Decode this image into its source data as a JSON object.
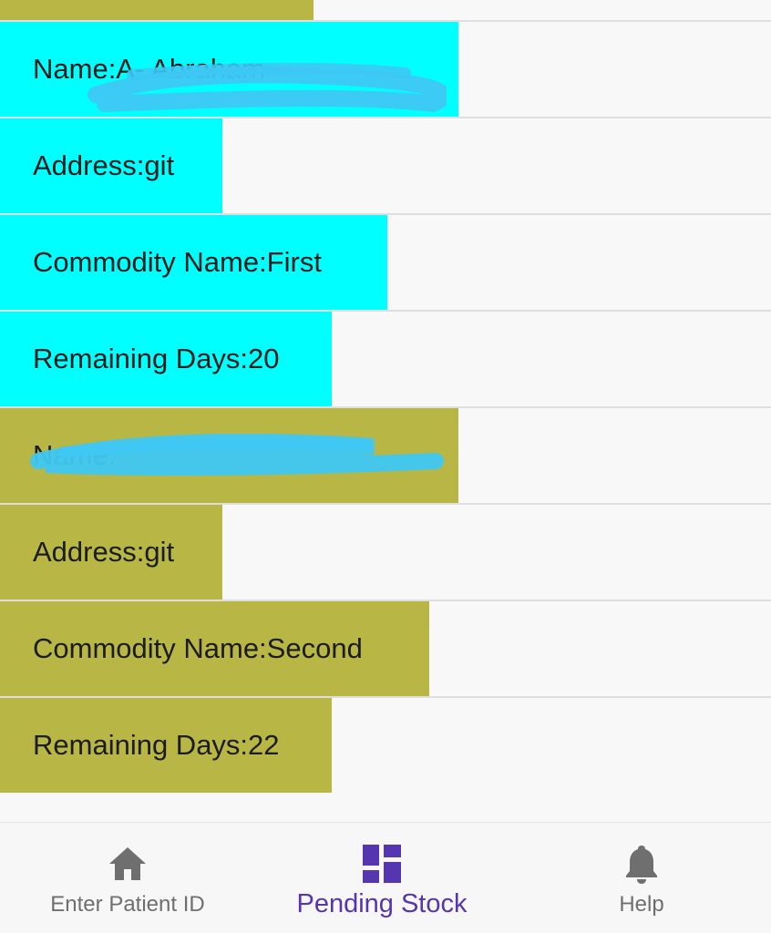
{
  "accent_color": "#5635b1",
  "record_colors": {
    "first": "#00ffff",
    "second": "#b8b645"
  },
  "records": [
    {
      "name_label": "Name:A‐           Abraham",
      "address_label": "Address:git",
      "commodity_label": "Commodity Name:First",
      "remaining_label": "Remaining Days:20"
    },
    {
      "name_label": "Name:",
      "address_label": "Address:git",
      "commodity_label": "Commodity Name:Second",
      "remaining_label": "Remaining Days:22"
    }
  ],
  "bottom_nav": {
    "items": [
      {
        "label": "Enter Patient ID",
        "icon": "home-icon"
      },
      {
        "label": "Pending Stock",
        "icon": "dashboard-icon",
        "active": true
      },
      {
        "label": "Help",
        "icon": "bell-icon"
      }
    ]
  }
}
